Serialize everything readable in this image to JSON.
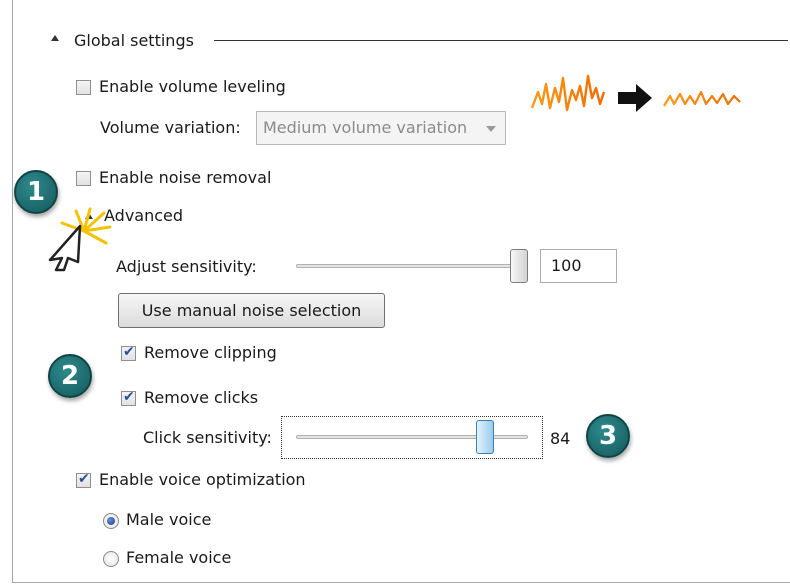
{
  "global_settings": {
    "heading": "Global settings"
  },
  "volume_leveling": {
    "label": "Enable volume leveling",
    "checked": false,
    "variation_label": "Volume variation:",
    "variation_value": "Medium volume variation"
  },
  "noise_removal": {
    "label": "Enable noise removal",
    "checked": false,
    "advanced_label": "Advanced",
    "sensitivity_label": "Adjust sensitivity:",
    "sensitivity_value": "100",
    "manual_button": "Use manual noise selection"
  },
  "clipping": {
    "label": "Remove clipping",
    "checked": true
  },
  "clicks": {
    "label": "Remove clicks",
    "checked": true,
    "sensitivity_label": "Click sensitivity:",
    "sensitivity_value": "84"
  },
  "voice": {
    "label": "Enable voice optimization",
    "checked": true,
    "male_label": "Male voice",
    "female_label": "Female voice",
    "selected": "Male voice"
  },
  "callouts": [
    "1",
    "2",
    "3"
  ],
  "colors": {
    "badge": "#1f6f73",
    "waveform": "#f57c00",
    "checkmark": "#2a4f9c"
  },
  "icons": {
    "illustration": "volume-leveling-illustration",
    "cursor": "mouse-cursor-icon",
    "click_burst": "click-burst-icon"
  }
}
